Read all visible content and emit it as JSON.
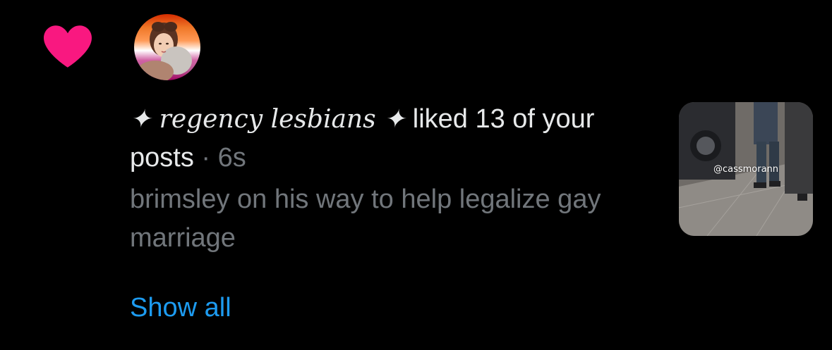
{
  "notification": {
    "icon": "heart-icon",
    "icon_color": "#f91880",
    "avatar": "user-avatar",
    "display_name": "✦ regency lesbians ✦",
    "action_text": " liked 13 of your posts",
    "separator": " · ",
    "time_ago": "6s",
    "post_snippet": "brimsley on his way to help legalize gay marriage",
    "show_all_label": "Show all",
    "thumbnail_watermark": "@cassmorann"
  },
  "colors": {
    "background": "#000000",
    "primary_text": "#e7e9ea",
    "secondary_text": "#71767b",
    "link": "#1d9bf0",
    "like": "#f91880"
  }
}
